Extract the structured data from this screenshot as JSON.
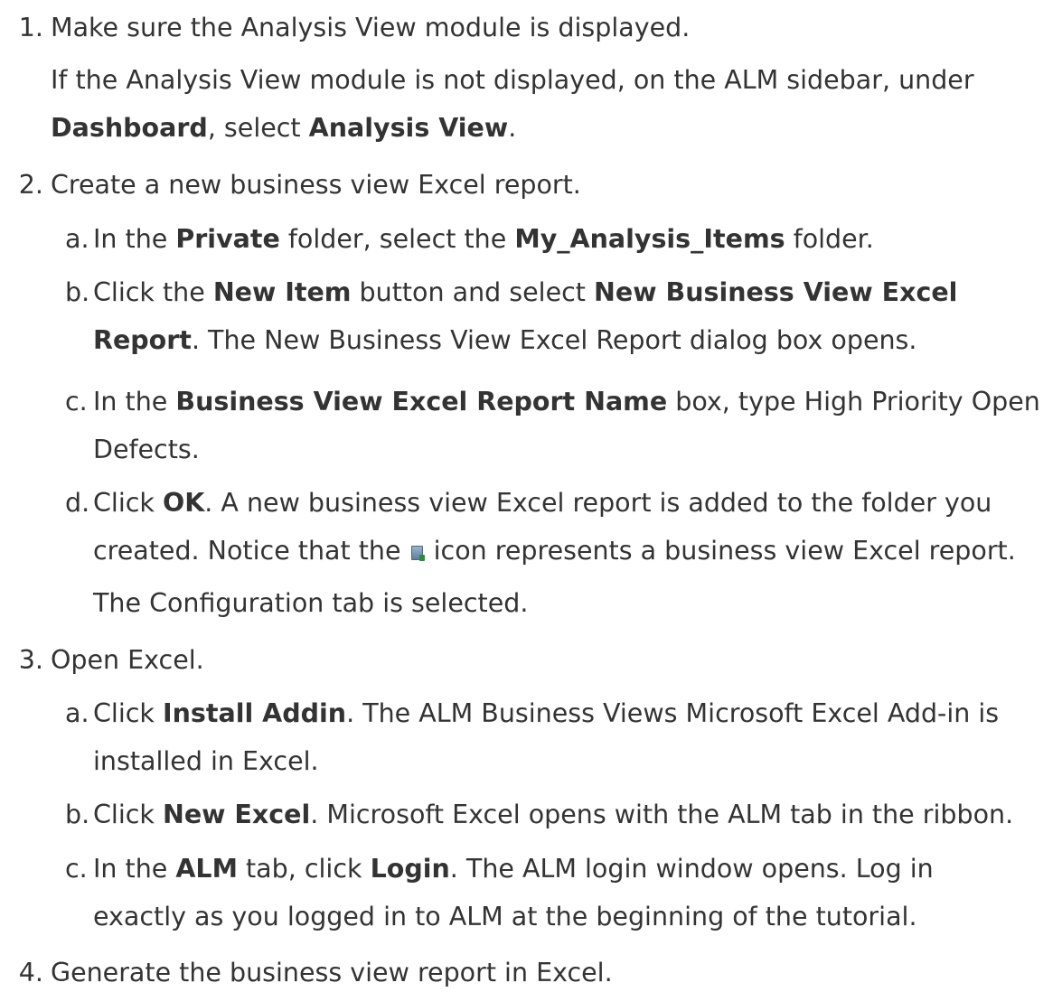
{
  "steps": [
    {
      "number": "1.",
      "text": "Make sure the Analysis View module is displayed.",
      "note": {
        "p1": "If the Analysis View module is not displayed, on the ALM sidebar, under",
        "b1": "Dashboard",
        "p2": ", select ",
        "b2": "Analysis View",
        "p3": "."
      }
    },
    {
      "number": "2.",
      "text": "Create a new business view Excel report.",
      "substeps": [
        {
          "letter": "a.",
          "p1": "In the ",
          "b1": "Private",
          "p2": " folder, select the ",
          "b2": "My_Analysis_Items",
          "p3": " folder."
        },
        {
          "letter": "b.",
          "p1": "Click the ",
          "b1": "New Item",
          "p2": " button and select ",
          "b2": "New Business View Excel",
          "b3": "Report",
          "p3": ". The New Business View Excel Report dialog box opens."
        },
        {
          "letter": "c.",
          "p1": "In the ",
          "b1": "Business View Excel Report Name",
          "p2": " box, type High Priority Open",
          "p3": "Defects."
        },
        {
          "letter": "d.",
          "p1": "Click ",
          "b1": "OK",
          "p2": ". A new business view Excel report is added to the folder you",
          "p3": "created. Notice that the ",
          "icon": "business-view-excel-report-icon",
          "p4": " icon represents a business view Excel report.",
          "note": "The Configuration tab is selected."
        }
      ]
    },
    {
      "number": "3.",
      "text": "Open Excel.",
      "substeps": [
        {
          "letter": "a.",
          "p1": "Click ",
          "b1": "Install Addin",
          "p2": ". The ALM Business Views Microsoft Excel Add-in is",
          "p3": "installed in Excel."
        },
        {
          "letter": "b.",
          "p1": "Click ",
          "b1": "New Excel",
          "p2": ". Microsoft Excel opens with the ALM tab in the ribbon."
        },
        {
          "letter": "c.",
          "p1": "In the ",
          "b1": "ALM",
          "p2": " tab, click ",
          "b2": "Login",
          "p3": ". The ALM login window opens. Log in",
          "p4": "exactly as you logged in to ALM at the beginning of the tutorial."
        }
      ]
    },
    {
      "number": "4.",
      "text": "Generate the business view report in Excel."
    }
  ]
}
